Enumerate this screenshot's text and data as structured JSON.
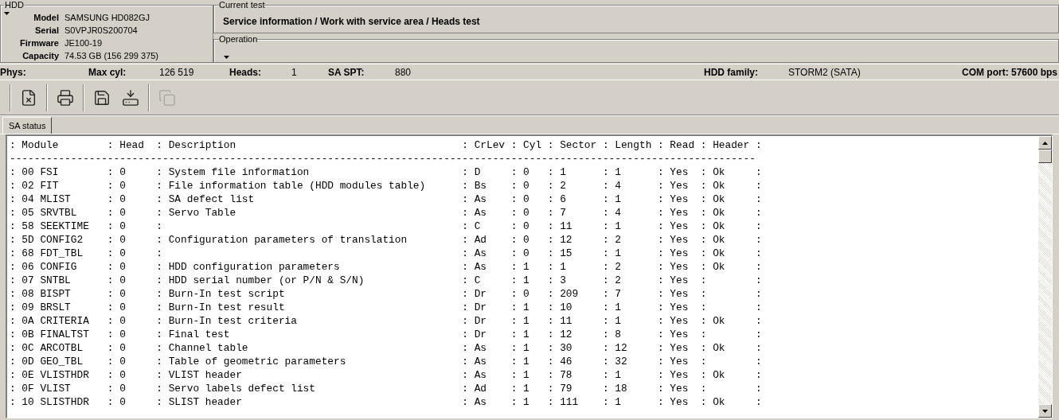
{
  "hdd_panel": {
    "title": "HDD",
    "fields": [
      {
        "label": "Model",
        "value": "SAMSUNG HD082GJ"
      },
      {
        "label": "Serial",
        "value": "S0VPJR0S200704"
      },
      {
        "label": "Firmware",
        "value": "JE100-19"
      },
      {
        "label": "Capacity",
        "value": "74.53 GB (156 299 375)"
      }
    ]
  },
  "current_test": {
    "title": "Current test",
    "path": "Service information / Work with service area / Heads test"
  },
  "operation": {
    "title": "Operation"
  },
  "status_bar": {
    "items": [
      {
        "label": "Phys:"
      },
      {
        "label": "Max cyl:",
        "value": "126 519"
      },
      {
        "label": "Heads:",
        "value": "1"
      },
      {
        "label": "SA SPT:",
        "value": "880"
      },
      {
        "label": "HDD family:",
        "value": "STORM2 (SATA)"
      }
    ],
    "com_port": "COM port: 57600 bps"
  },
  "toolbar": {
    "buttons": [
      {
        "kind": "clear",
        "disabled": false
      },
      {
        "kind": "print",
        "disabled": false
      },
      {
        "kind": "save",
        "disabled": false
      },
      {
        "kind": "load",
        "disabled": false
      },
      {
        "kind": "copy",
        "disabled": true
      }
    ]
  },
  "tabs": [
    {
      "label": "SA status",
      "selected": true
    }
  ],
  "log": {
    "lines": [
      ": Module        : Head  : Description                                     : CrLev : Cyl : Sector : Length : Read : Header :",
      "--------------------------------------------------------------------------------------------------------------------------",
      ": 00 FSI        : 0     : System file information                         : D     : 0   : 1      : 1      : Yes  : Ok     :",
      ": 02 FIT        : 0     : File information table (HDD modules table)      : Bs    : 0   : 2      : 4      : Yes  : Ok     :",
      ": 04 MLIST      : 0     : SA defect list                                  : As    : 0   : 6      : 1      : Yes  : Ok     :",
      ": 05 SRVTBL     : 0     : Servo Table                                     : As    : 0   : 7      : 4      : Yes  : Ok     :",
      ": 58 SEEKTIME   : 0     :                                                 : C     : 0   : 11     : 1      : Yes  : Ok     :",
      ": 5D CONFIG2    : 0     : Configuration parameters of translation         : Ad    : 0   : 12     : 2      : Yes  : Ok     :",
      ": 68 FDT_TBL    : 0     :                                                 : As    : 0   : 15     : 1      : Yes  : Ok     :",
      ": 06 CONFIG     : 0     : HDD configuration parameters                    : As    : 1   : 1      : 2      : Yes  : Ok     :",
      ": 07 SNTBL      : 0     : HDD serial number (or P/N & S/N)                : C     : 1   : 3      : 2      : Yes  :        :",
      ": 08 BISPT      : 0     : Burn-In test script                             : Dr    : 0   : 209    : 7      : Yes  :        :",
      ": 09 BRSLT      : 0     : Burn-In test result                             : Dr    : 1   : 10     : 1      : Yes  :        :",
      ": 0A CRITERIA   : 0     : Burn-In test criteria                           : Dr    : 1   : 11     : 1      : Yes  : Ok     :",
      ": 0B FINALTST   : 0     : Final test                                      : Dr    : 1   : 12     : 8      : Yes  :        :",
      ": 0C ARCOTBL    : 0     : Channel table                                   : As    : 1   : 30     : 12     : Yes  : Ok     :",
      ": 0D GEO_TBL    : 0     : Table of geometric parameters                   : As    : 1   : 46     : 32     : Yes  :        :",
      ": 0E VLISTHDR   : 0     : VLIST header                                    : As    : 1   : 78     : 1      : Yes  : Ok     :",
      ": 0F VLIST      : 0     : Servo labels defect list                        : Ad    : 1   : 79     : 18     : Yes  :        :",
      ": 10 SLISTHDR   : 0     : SLIST header                                    : As    : 1   : 111    : 1      : Yes  : Ok     :"
    ]
  }
}
